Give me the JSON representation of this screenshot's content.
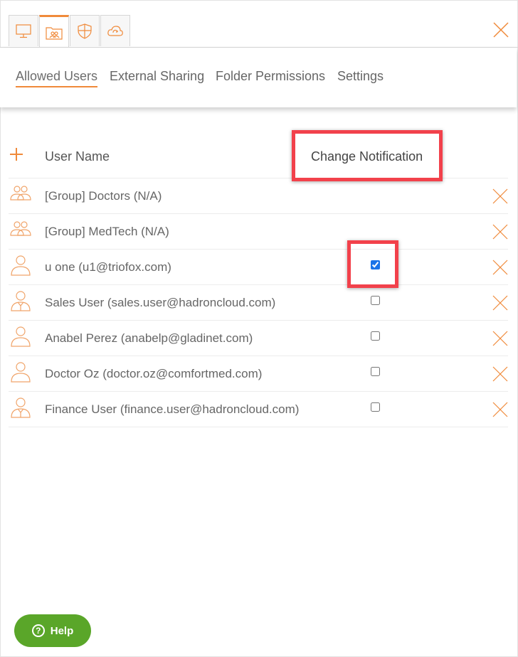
{
  "icon_tabs": [
    {
      "icon": "computer-icon",
      "active": false
    },
    {
      "icon": "shared-folder-icon",
      "active": true
    },
    {
      "icon": "shield-icon",
      "active": false
    },
    {
      "icon": "cloud-sync-icon",
      "active": false
    }
  ],
  "subtabs": [
    {
      "label": "Allowed Users",
      "active": true
    },
    {
      "label": "External Sharing",
      "active": false
    },
    {
      "label": "Folder Permissions",
      "active": false
    },
    {
      "label": "Settings",
      "active": false
    }
  ],
  "table": {
    "header_user": "User Name",
    "header_notification": "Change Notification"
  },
  "users": [
    {
      "name": "[Group] Doctors (N/A)",
      "type": "group",
      "has_checkbox": false,
      "checked": false
    },
    {
      "name": "[Group] MedTech (N/A)",
      "type": "group",
      "has_checkbox": false,
      "checked": false
    },
    {
      "name": "u one (u1@triofox.com)",
      "type": "user",
      "has_checkbox": true,
      "checked": true
    },
    {
      "name": "Sales User (sales.user@hadroncloud.com)",
      "type": "business-user",
      "has_checkbox": true,
      "checked": false
    },
    {
      "name": "Anabel Perez (anabelp@gladinet.com)",
      "type": "user",
      "has_checkbox": true,
      "checked": false
    },
    {
      "name": "Doctor Oz (doctor.oz@comfortmed.com)",
      "type": "user",
      "has_checkbox": true,
      "checked": false
    },
    {
      "name": "Finance User (finance.user@hadroncloud.com)",
      "type": "business-user",
      "has_checkbox": true,
      "checked": false
    }
  ],
  "help": {
    "label": "Help"
  },
  "colors": {
    "accent": "#f08a3a",
    "highlight": "#f2414b",
    "help_green": "#5aa629"
  }
}
